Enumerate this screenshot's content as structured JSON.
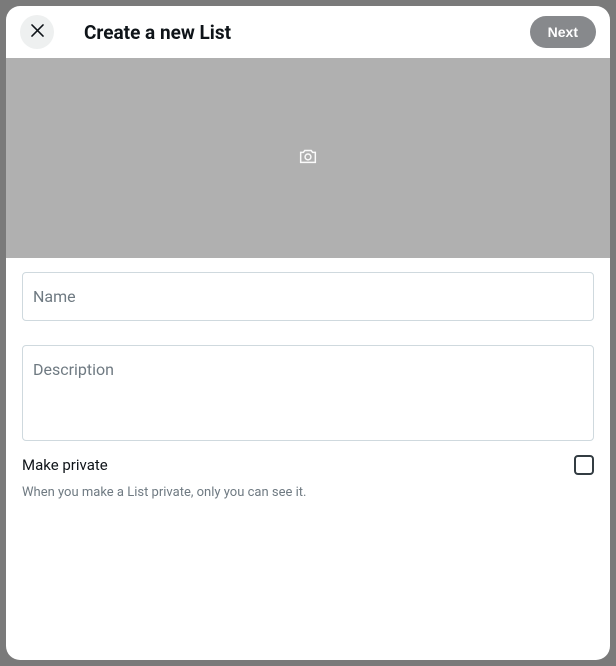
{
  "header": {
    "title": "Create a new List",
    "next_label": "Next"
  },
  "fields": {
    "name_label": "Name",
    "description_label": "Description"
  },
  "privacy": {
    "label": "Make private",
    "help": "When you make a List private, only you can see it."
  }
}
